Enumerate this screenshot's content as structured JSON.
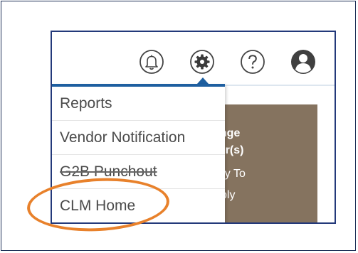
{
  "header": {
    "icons": [
      "bell-icon",
      "gear-icon",
      "help-icon",
      "user-icon"
    ]
  },
  "dropdown": {
    "items": [
      {
        "label": "Reports"
      },
      {
        "label": "Vendor Notification"
      },
      {
        "label": "G2B Punchout"
      },
      {
        "label": "CLM Home"
      }
    ]
  },
  "panel": {
    "line1": "ange",
    "line2": "der(s)",
    "line3": "ady To",
    "line4": "ply"
  },
  "colors": {
    "accent_blue": "#1e5fa0",
    "frame_navy": "#23397a",
    "panel_brown": "#85735f",
    "highlight_orange": "#e8812b"
  }
}
